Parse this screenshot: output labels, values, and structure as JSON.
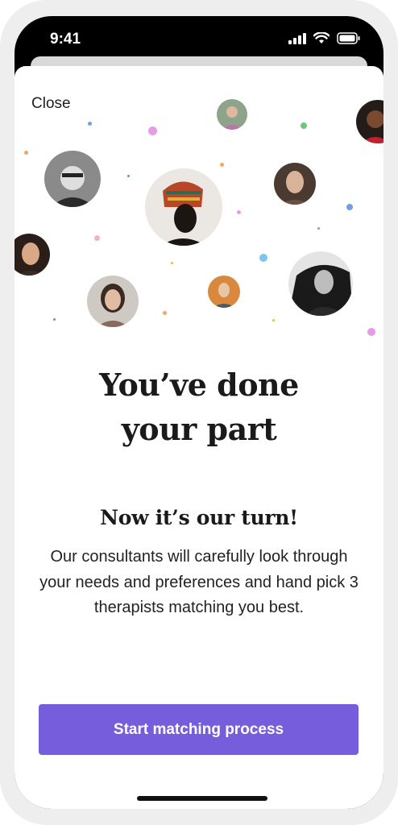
{
  "status_bar": {
    "time": "9:41"
  },
  "header": {
    "close_label": "Close"
  },
  "hero": {
    "title_line1": "You’ve done",
    "title_line2": "your part"
  },
  "content": {
    "subtitle": "Now it’s our turn!",
    "body": "Our consultants will carefully look through your needs and preferences and hand pick 3 therapists matching you best."
  },
  "cta": {
    "label": "Start matching process"
  },
  "colors": {
    "accent": "#765ddc",
    "dot_pink": "#e59be8",
    "dot_green": "#6cc77e",
    "dot_blue": "#6ea0e8",
    "dot_sky": "#7cc4ee",
    "dot_orange": "#f0a66a"
  }
}
